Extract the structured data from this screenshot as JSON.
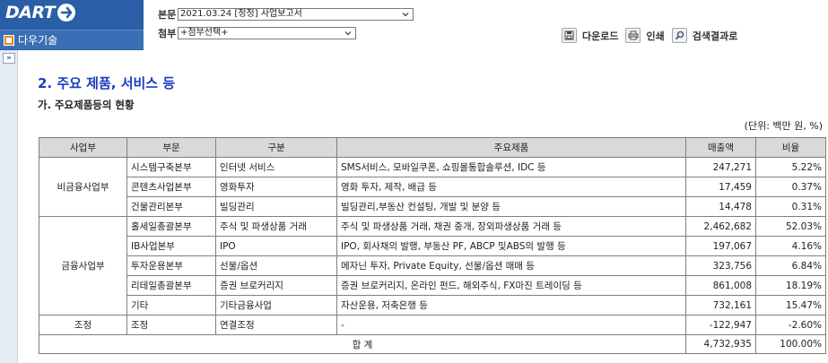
{
  "header": {
    "logo_text": "DART",
    "company_name": "다우기술",
    "report_label": "본문",
    "report_value": "2021.03.24 [정정] 사업보고서",
    "attach_label": "첨부",
    "attach_value": "+첨부선택+",
    "toolbar": {
      "download": "다운로드",
      "print": "인쇄",
      "search_results": "검색결과로"
    }
  },
  "left_strip": {
    "expand": "»"
  },
  "content": {
    "section_title": "2. 주요 제품, 서비스 등",
    "sub_title": "가. 주요제품등의 현황",
    "unit_note": "(단위: 백만 원, %)",
    "table": {
      "headers": [
        "사업부",
        "부문",
        "구분",
        "주요제품",
        "매출액",
        "비율"
      ],
      "groups": [
        {
          "division": "비금융사업부"
        },
        {
          "division": "금융사업부"
        },
        {
          "division": "조정"
        }
      ],
      "rows": [
        [
          "시스템구축본부",
          "인터넷 서비스",
          "SMS서비스, 모바일쿠폰, 쇼핑몰통합솔루션, IDC 등",
          "247,271",
          "5.22%"
        ],
        [
          "콘텐츠사업본부",
          "영화투자",
          "영화 투자, 제작, 배급 등",
          "17,459",
          "0.37%"
        ],
        [
          "건물관리본부",
          "빌딩관리",
          "빌딩관리,부동산 컨설팅, 개발 및 분양 등",
          "14,478",
          "0.31%"
        ],
        [
          "홀세일총괄본부",
          "주식 및 파생상품 거래",
          "주식 및 파생상품 거래, 채권 중개, 장외파생상품 거래 등",
          "2,462,682",
          "52.03%"
        ],
        [
          "IB사업본부",
          "IPO",
          "IPO, 회사채의 발행, 부동산 PF, ABCP 및ABS의 발행 등",
          "197,067",
          "4.16%"
        ],
        [
          "투자운용본부",
          "선물/옵션",
          "메자닌 투자, Private Equity, 선물/옵션 매매 등",
          "323,756",
          "6.84%"
        ],
        [
          "리테일총괄본부",
          "증권 브로커리지",
          "증권 브로커리지, 온라인 펀드, 해외주식, FX마진 트레이딩 등",
          "861,008",
          "18.19%"
        ],
        [
          "기타",
          "기타금융사업",
          "자산운용, 저축은행 등",
          "732,161",
          "15.47%"
        ],
        [
          "조정",
          "연결조정",
          "-",
          "-122,947",
          "-2.60%"
        ]
      ],
      "total": {
        "label": "합 계",
        "sales": "4,732,935",
        "ratio": "100.00%"
      }
    }
  }
}
